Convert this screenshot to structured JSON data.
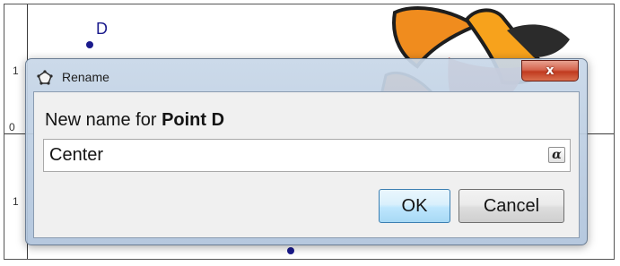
{
  "canvas": {
    "point_label": "D",
    "y_tick_top": "1",
    "y_tick_zero": "0",
    "y_tick_bottom": "1",
    "y_tick_top_edge": "",
    "y_tick_bottom_edge": "",
    "point_color": "#1a1a8c"
  },
  "dialog": {
    "title": "Rename",
    "close_glyph": "x",
    "prompt_prefix": "New name for ",
    "prompt_object": "Point D",
    "name_value": "Center",
    "alpha_glyph": "α",
    "ok_label": "OK",
    "cancel_label": "Cancel"
  },
  "icons": {
    "title_icon": "polygon-shape-icon",
    "alpha_button": "alpha-symbol-icon",
    "close_button": "close-icon"
  },
  "colors": {
    "ok_border": "#3c7fb1",
    "close_red": "#c13a1f",
    "text": "#141414"
  }
}
